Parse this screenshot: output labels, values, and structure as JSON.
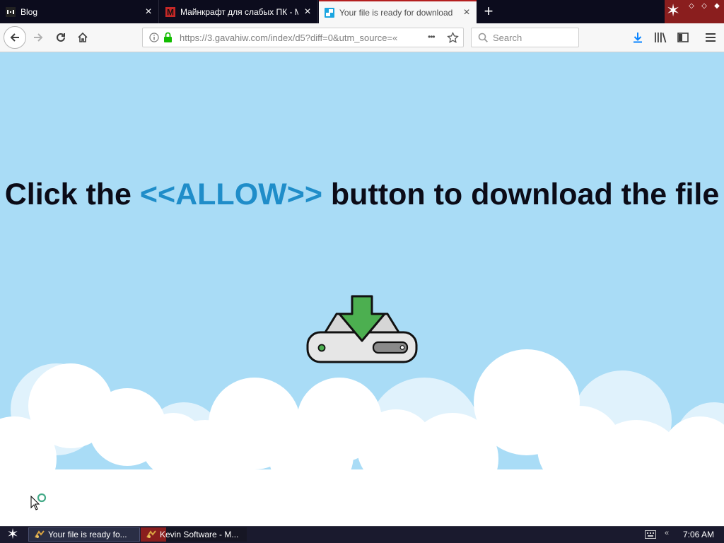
{
  "tabs": [
    {
      "label": "Blog",
      "close": "×",
      "active": false
    },
    {
      "label": "Майнкрафт для слабых ПК - Mine",
      "close": "×",
      "active": false
    },
    {
      "label": "Your file is ready for download",
      "close": "×",
      "active": true
    }
  ],
  "new_tab_label": "+",
  "nav": {
    "url": "https://3.gavahiw.com/index/d5?diff=0&utm_source=...",
    "url_display": "https://3.gavahiw.com/index/d5?diff=0&utm_source=«",
    "page_actions": "•••",
    "search_placeholder": "Search"
  },
  "page": {
    "headline_before": "Click the ",
    "headline_allow": "<<ALLOW>>",
    "headline_after": " button to download the file"
  },
  "taskbar": {
    "tasks": [
      {
        "label": "Your file is ready fo..."
      },
      {
        "label": "Kevin Software - M..."
      }
    ],
    "tray_chevron": "«",
    "clock": "7:06 AM"
  },
  "colors": {
    "sky": "#a9dcf6",
    "allow_text": "#1f8dc9",
    "active_tab_accent": "#b41f1f",
    "download_arrow": "#4caf50",
    "tab_strip": "#0c0c1d"
  },
  "icons": [
    "back-icon",
    "forward-icon",
    "reload-icon",
    "home-icon",
    "info-icon",
    "lock-icon",
    "bookmark-star-icon",
    "search-icon",
    "downloads-icon",
    "library-icon",
    "sidebar-icon",
    "menu-icon",
    "download-drive-icon"
  ]
}
